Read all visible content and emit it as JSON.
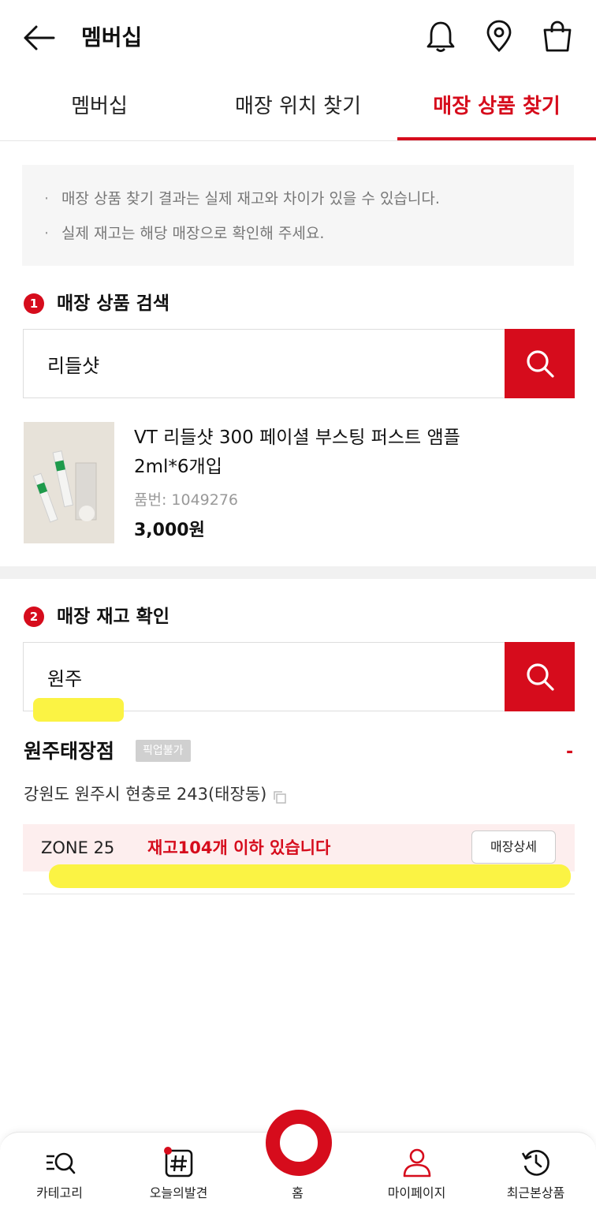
{
  "header": {
    "title": "멤버십",
    "icons": [
      "back-arrow-icon",
      "bell-icon",
      "location-pin-icon",
      "shopping-bag-icon"
    ]
  },
  "tabs": [
    {
      "label": "멤버십",
      "active": false
    },
    {
      "label": "매장 위치 찾기",
      "active": false
    },
    {
      "label": "매장 상품 찾기",
      "active": true
    }
  ],
  "notice": [
    "매장 상품 찾기 결과는 실제 재고와 차이가 있을 수 있습니다.",
    "실제 재고는 해당 매장으로 확인해 주세요."
  ],
  "step1": {
    "number": "1",
    "title": "매장 상품 검색",
    "search_value": "리들샷"
  },
  "product": {
    "name": "VT 리들샷 300 페이셜 부스팅 퍼스트 앰플 2ml*6개입",
    "code_label": "품번: 1049276",
    "price": "3,000원"
  },
  "step2": {
    "number": "2",
    "title": "매장 재고 확인",
    "search_value": "원주"
  },
  "store": {
    "name": "원주태장점",
    "badge": "픽업불가",
    "collapse": "-",
    "address": "강원도 원주시 현충로 243(태장동)",
    "zone": "ZONE 25",
    "stock": "재고104개 이하 있습니다",
    "detail_button": "매장상세"
  },
  "bottom_nav": [
    {
      "label": "카테고리",
      "icon": "category-search-icon"
    },
    {
      "label": "오늘의발견",
      "icon": "hashtag-icon"
    },
    {
      "label": "홈",
      "icon": "home-ring-icon"
    },
    {
      "label": "마이페이지",
      "icon": "person-icon"
    },
    {
      "label": "최근본상품",
      "icon": "history-icon"
    }
  ],
  "colors": {
    "accent": "#d60c1c",
    "zone_bg": "#fdeeee",
    "highlighter": "#fbf23a"
  }
}
